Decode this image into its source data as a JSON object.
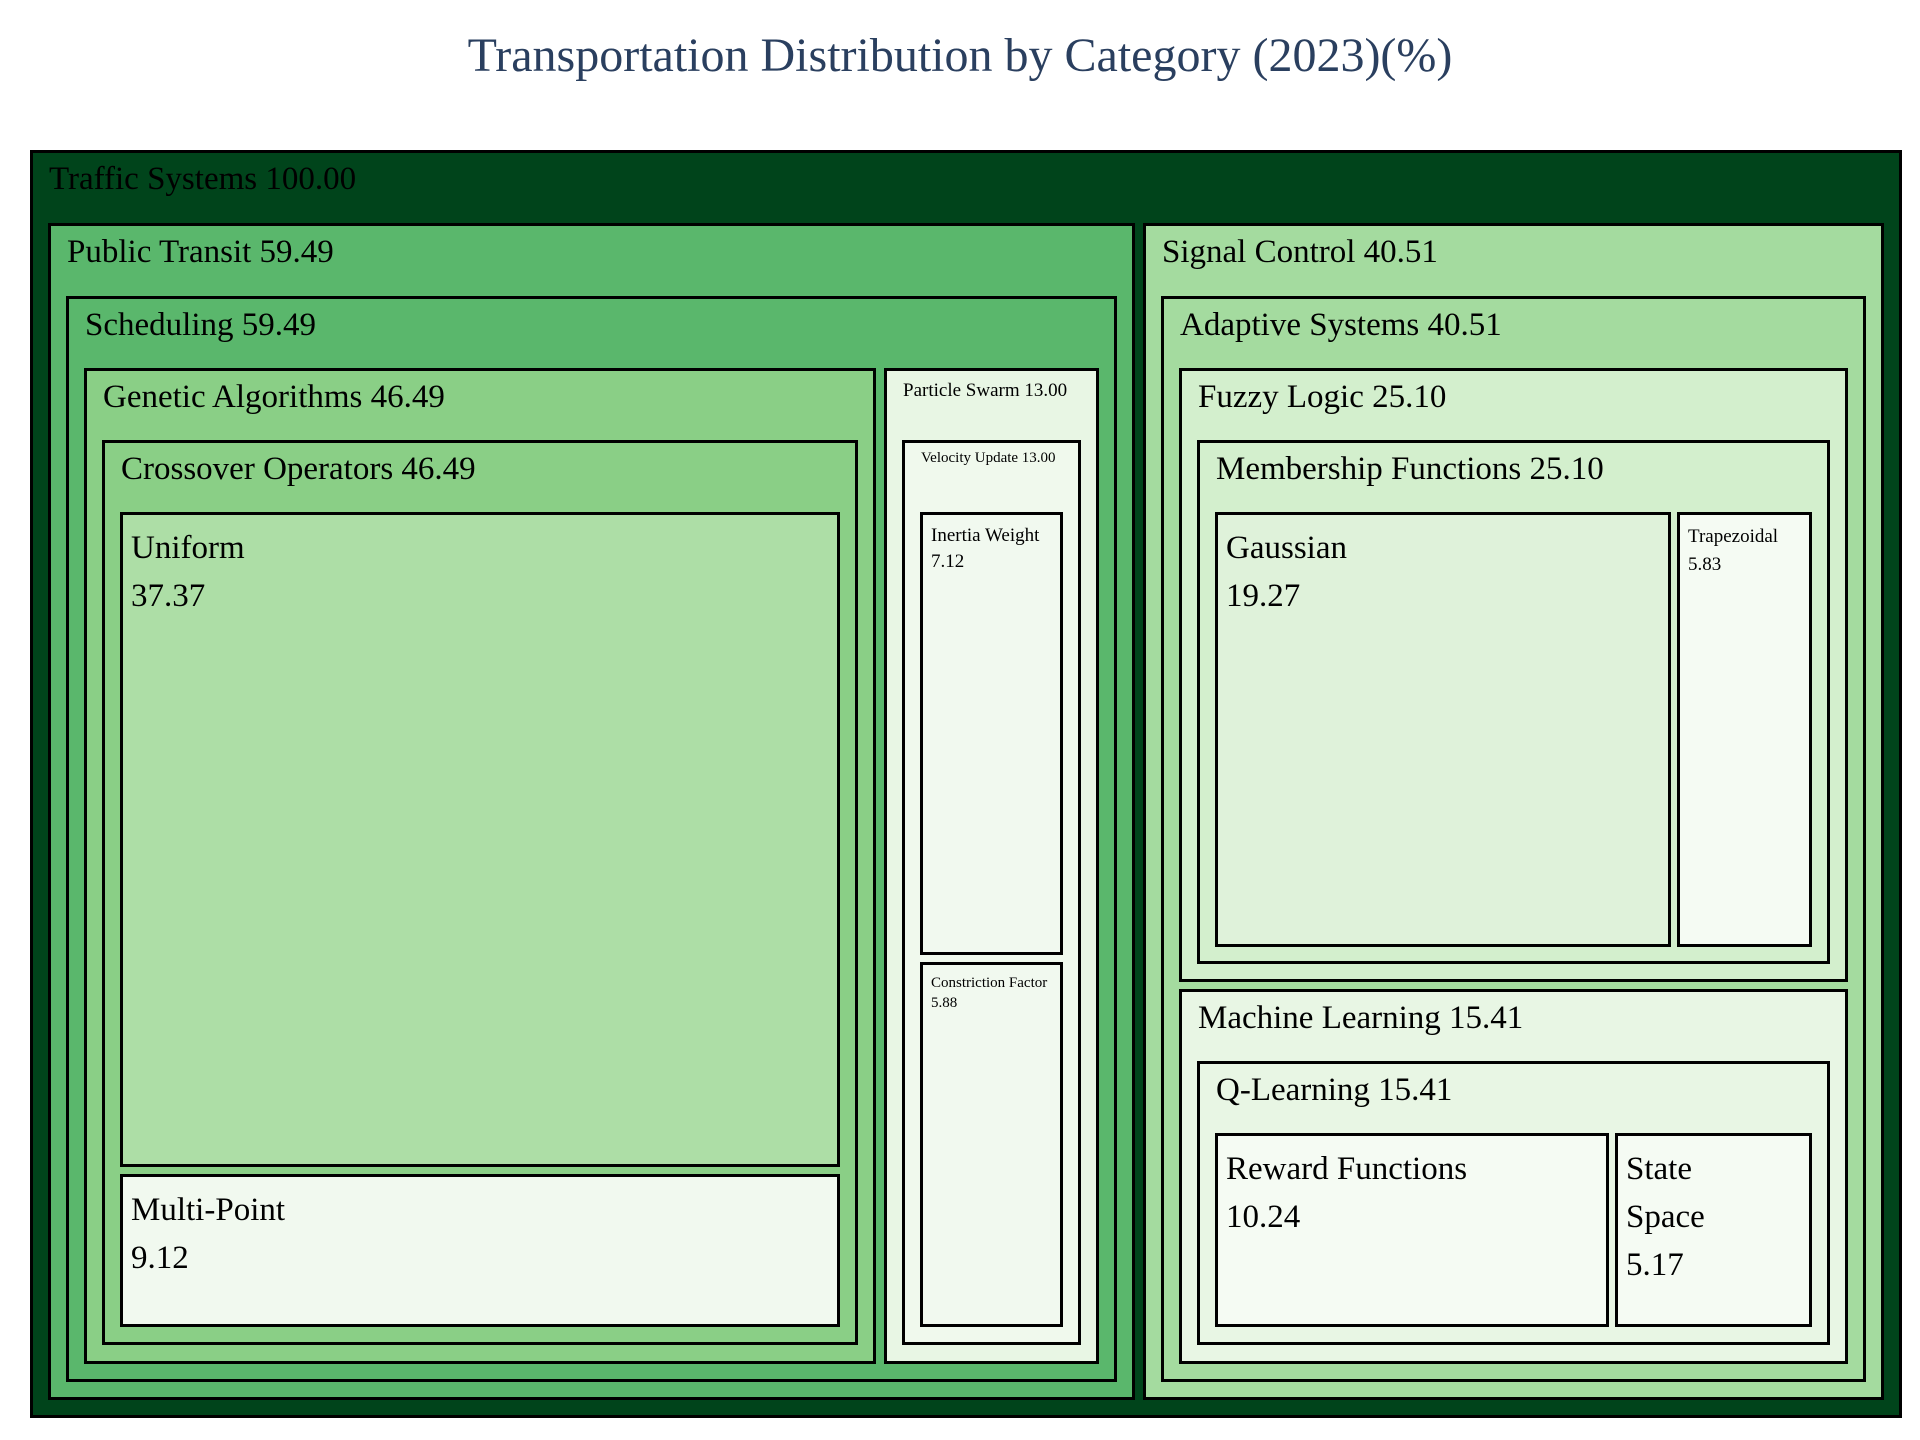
{
  "chart_data": {
    "type": "treemap",
    "title": "Transportation Distribution by Category (2023)(%)",
    "unit": "%",
    "colors": {
      "depth0": "#00441b",
      "depth1_a": "#5ab76c",
      "depth1_b": "#a4db9f",
      "depth2_a": "#5ab76c",
      "depth2_b": "#a4db9f",
      "depth3_a": "#8acf86",
      "depth3_b": "#e8f6e4",
      "depth3_c": "#d3efcd",
      "depth4_a": "#8acf86",
      "depth4_b": "#f0f9ed",
      "depth4_c": "#d3efcd",
      "depth4_d": "#e8f6e4",
      "leaf_uniform": "#addea6",
      "leaf_pale": "#f1f9ef",
      "leaf_gaussian": "#dff2da",
      "leaf_other": "#f5fbf3",
      "border": "#000000",
      "title": "#2a3f5f"
    },
    "root": {
      "id": "traffic-systems",
      "name": "Traffic Systems",
      "value": 100.0,
      "children": [
        {
          "id": "public-transit",
          "name": "Public Transit",
          "value": 59.49,
          "children": [
            {
              "id": "scheduling",
              "name": "Scheduling",
              "value": 59.49,
              "children": [
                {
                  "id": "genetic-algorithms",
                  "name": "Genetic Algorithms",
                  "value": 46.49,
                  "children": [
                    {
                      "id": "crossover-operators",
                      "name": "Crossover Operators",
                      "value": 46.49,
                      "children": [
                        {
                          "id": "uniform",
                          "name": "Uniform",
                          "value": 37.37
                        },
                        {
                          "id": "multi-point",
                          "name": "Multi-Point",
                          "value": 9.12
                        }
                      ]
                    }
                  ]
                },
                {
                  "id": "particle-swarm",
                  "name": "Particle Swarm",
                  "value": 13.0,
                  "children": [
                    {
                      "id": "velocity-update",
                      "name": "Velocity Update",
                      "value": 13.0,
                      "children": [
                        {
                          "id": "inertia-weight",
                          "name": "Inertia Weight",
                          "value": 7.12
                        },
                        {
                          "id": "constriction-factor",
                          "name": "Constriction Factor",
                          "value": 5.88
                        }
                      ]
                    }
                  ]
                }
              ]
            }
          ]
        },
        {
          "id": "signal-control",
          "name": "Signal Control",
          "value": 40.51,
          "children": [
            {
              "id": "adaptive-systems",
              "name": "Adaptive Systems",
              "value": 40.51,
              "children": [
                {
                  "id": "fuzzy-logic",
                  "name": "Fuzzy Logic",
                  "value": 25.1,
                  "children": [
                    {
                      "id": "membership-functions",
                      "name": "Membership Functions",
                      "value": 25.1,
                      "children": [
                        {
                          "id": "gaussian",
                          "name": "Gaussian",
                          "value": 19.27
                        },
                        {
                          "id": "trapezoidal",
                          "name": "Trapezoidal",
                          "value": 5.83
                        }
                      ]
                    }
                  ]
                },
                {
                  "id": "machine-learning",
                  "name": "Machine Learning",
                  "value": 15.41,
                  "children": [
                    {
                      "id": "q-learning",
                      "name": "Q-Learning",
                      "value": 15.41,
                      "children": [
                        {
                          "id": "reward-functions",
                          "name": "Reward Functions",
                          "value": 10.24
                        },
                        {
                          "id": "state-space",
                          "name": "State Space",
                          "value": 5.17
                        }
                      ]
                    }
                  ]
                }
              ]
            }
          ]
        }
      ]
    }
  }
}
